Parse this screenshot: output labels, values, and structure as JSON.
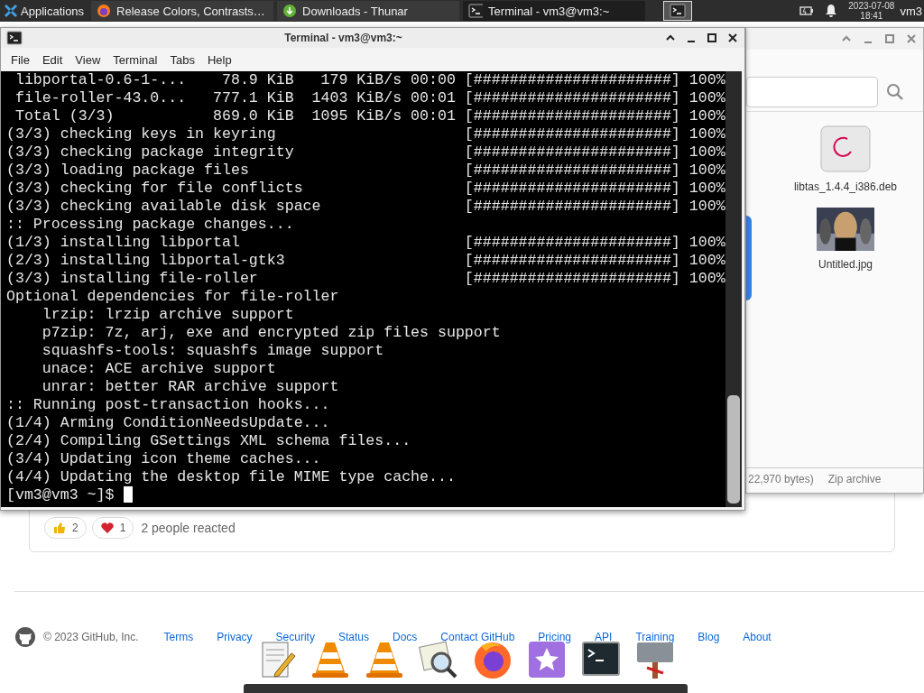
{
  "top_panel": {
    "applications_label": "Applications",
    "tasks": [
      {
        "title": "Release Colors, Contrasts…",
        "kind": "browser",
        "selected": false
      },
      {
        "title": "Downloads - Thunar",
        "kind": "download",
        "selected": false
      },
      {
        "title": "Terminal - vm3@vm3:~",
        "kind": "terminal",
        "selected": true
      }
    ],
    "date": "2023-07-08",
    "time": "18:41",
    "user": "vm3"
  },
  "browser_page": {
    "reactions": [
      {
        "kind": "thumbs_up",
        "count": "2"
      },
      {
        "kind": "heart",
        "count": "1"
      }
    ],
    "reaction_summary": "2 people reacted",
    "footer": {
      "copyright": "© 2023 GitHub, Inc.",
      "links": [
        "Terms",
        "Privacy",
        "Security",
        "Status",
        "Docs",
        "Contact GitHub",
        "Pricing",
        "API",
        "Training",
        "Blog",
        "About"
      ]
    }
  },
  "thunar_window": {
    "files": [
      {
        "name": "libtas_1.4.4_i386.deb",
        "kind": "package"
      },
      {
        "name": "Untitled.jpg",
        "kind": "picture"
      }
    ],
    "status": [
      "22,970 bytes)",
      "Zip archive"
    ]
  },
  "terminal_window": {
    "title": "Terminal - vm3@vm3:~",
    "menu": [
      "File",
      "Edit",
      "View",
      "Terminal",
      "Tabs",
      "Help"
    ],
    "lines": [
      {
        "text": " libportal-0.6-1-...    78.9 KiB   179 KiB/s 00:00",
        "progress": "[######################] 100%"
      },
      {
        "text": " file-roller-43.0...   777.1 KiB  1403 KiB/s 00:01",
        "progress": "[######################] 100%"
      },
      {
        "text": " Total (3/3)           869.0 KiB  1095 KiB/s 00:01",
        "progress": "[######################] 100%"
      },
      {
        "text": "(3/3) checking keys in keyring",
        "progress": "[######################] 100%"
      },
      {
        "text": "(3/3) checking package integrity",
        "progress": "[######################] 100%"
      },
      {
        "text": "(3/3) loading package files",
        "progress": "[######################] 100%"
      },
      {
        "text": "(3/3) checking for file conflicts",
        "progress": "[######################] 100%"
      },
      {
        "text": "(3/3) checking available disk space",
        "progress": "[######################] 100%"
      },
      {
        "text": ":: Processing package changes..."
      },
      {
        "text": "(1/3) installing libportal",
        "progress": "[######################] 100%"
      },
      {
        "text": "(2/3) installing libportal-gtk3",
        "progress": "[######################] 100%"
      },
      {
        "text": "(3/3) installing file-roller",
        "progress": "[######################] 100%"
      },
      {
        "text": "Optional dependencies for file-roller"
      },
      {
        "text": "    lrzip: lrzip archive support"
      },
      {
        "text": "    p7zip: 7z, arj, exe and encrypted zip files support"
      },
      {
        "text": "    squashfs-tools: squashfs image support"
      },
      {
        "text": "    unace: ACE archive support"
      },
      {
        "text": "    unrar: better RAR archive support"
      },
      {
        "text": ":: Running post-transaction hooks..."
      },
      {
        "text": "(1/4) Arming ConditionNeedsUpdate..."
      },
      {
        "text": "(2/4) Compiling GSettings XML schema files..."
      },
      {
        "text": "(3/4) Updating icon theme caches..."
      },
      {
        "text": "(4/4) Updating the desktop file MIME type cache..."
      }
    ],
    "prompt": "[vm3@vm3 ~]$"
  },
  "dock": {
    "launchers": [
      {
        "kind": "editor"
      },
      {
        "kind": "cone"
      },
      {
        "kind": "cone"
      },
      {
        "kind": "viewer"
      },
      {
        "kind": "browser"
      },
      {
        "kind": "star"
      },
      {
        "kind": "terminal"
      },
      {
        "kind": "sign"
      }
    ]
  }
}
